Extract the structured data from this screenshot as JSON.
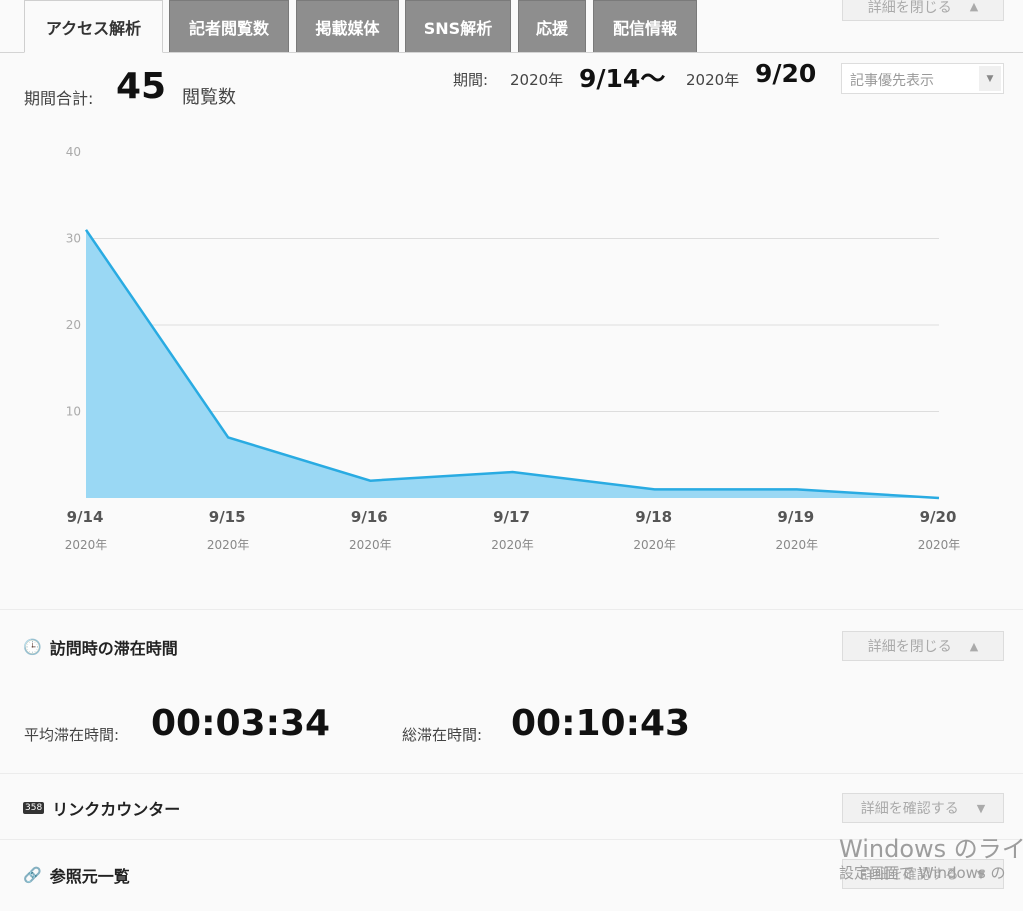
{
  "tabs": [
    {
      "label": "アクセス解析",
      "active": true
    },
    {
      "label": "記者閲覧数",
      "active": false
    },
    {
      "label": "掲載媒体",
      "active": false
    },
    {
      "label": "SNS解析",
      "active": false
    },
    {
      "label": "応援",
      "active": false
    },
    {
      "label": "配信情報",
      "active": false
    }
  ],
  "top_button": {
    "label": "詳細を閉じる",
    "icon": "triangle-up-icon"
  },
  "summary": {
    "total_label": "期間合計:",
    "total_value": "45",
    "total_unit": "閲覧数",
    "period_label": "期間:",
    "start_year": "2020年",
    "start_date": "9/14〜",
    "end_year": "2020年",
    "end_date": "9/20",
    "sort_select": "記事優先表示"
  },
  "chart_data": {
    "type": "area",
    "x": [
      "9/14",
      "9/15",
      "9/16",
      "9/17",
      "9/18",
      "9/19",
      "9/20"
    ],
    "x_sublabel": "2020年",
    "values": [
      31,
      7,
      2,
      3,
      1,
      1,
      0
    ],
    "ylim": [
      0,
      40
    ],
    "yticks": [
      10,
      20,
      30,
      40
    ],
    "colors": {
      "line": "#29abe2",
      "fill": "#9ad8f4",
      "grid": "#dddddd"
    }
  },
  "stay_section": {
    "title": "訪問時の滞在時間",
    "icon": "clock-icon",
    "button": "詳細を閉じる",
    "avg_label": "平均滞在時間:",
    "avg_value": "00:03:34",
    "total_label": "総滞在時間:",
    "total_value": "00:10:43"
  },
  "link_section": {
    "title": "リンクカウンター",
    "icon": "counter-icon",
    "icon_text": "358",
    "button": "詳細を確認する"
  },
  "ref_section": {
    "title": "参照元一覧",
    "icon": "link-icon",
    "button": "詳細を確認する"
  },
  "watermark": {
    "line1": "Windows のライセ",
    "line2": "設定画面で Windows の"
  }
}
